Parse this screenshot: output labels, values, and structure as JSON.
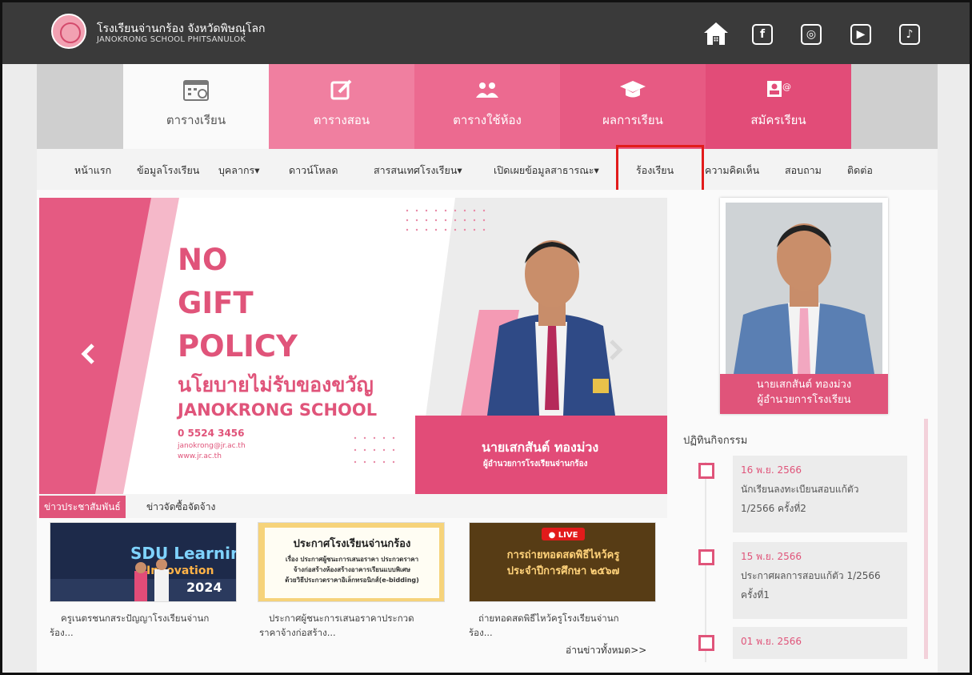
{
  "header": {
    "school_name_th": "โรงเรียนจ่านกร้อง จังหวัดพิษณุโลก",
    "school_name_en": "JANOKRONG SCHOOL PHITSANULOK",
    "icons": [
      "home-icon",
      "facebook-icon",
      "instagram-icon",
      "youtube-icon",
      "tiktok-icon"
    ],
    "icon_glyphs": {
      "facebook": "f",
      "instagram": "◎",
      "youtube": "▶",
      "tiktok": "♪"
    }
  },
  "tiles": [
    {
      "label": "ตารางเรียน",
      "icon": "calendar-icon"
    },
    {
      "label": "ตารางสอน",
      "icon": "edit-icon"
    },
    {
      "label": "ตารางใช้ห้อง",
      "icon": "users-icon"
    },
    {
      "label": "ผลการเรียน",
      "icon": "graduation-cap-icon"
    },
    {
      "label": "สมัครเรียน",
      "icon": "contact-card-icon"
    }
  ],
  "nav": {
    "home": "หน้าแรก",
    "school_info": "ข้อมูลโรงเรียน",
    "personnel": "บุคลากร▾",
    "download": "ดาวน์โหลด",
    "info_system": "สารสนเทศโรงเรียน▾",
    "public_info": "เปิดเผยข้อมูลสาธารณะ▾",
    "complaint": "ร้องเรียน",
    "opinion": "ความคิดเห็น",
    "survey": "สอบถาม",
    "contact": "ติดต่อ"
  },
  "banner": {
    "line1": "NO",
    "line2": "GIFT",
    "line3": "POLICY",
    "policy_th": "นโยบายไม่รับของขวัญ",
    "school": "JANOKRONG SCHOOL",
    "phone": "0 5524 3456",
    "email": "janokrong@jr.ac.th",
    "web": "www.jr.ac.th",
    "director_name": "นายเสกสันต์ ทองม่วง",
    "director_title": "ผู้อำนวยการโรงเรียนจ่านกร้อง"
  },
  "news": {
    "tabs": [
      "ข่าวประชาสัมพันธ์",
      "ข่าวจัดซื้อจัดจ้าง"
    ],
    "items": [
      {
        "caption_l1": "ครูเนตรชนกสระปัญญาโรงเรียนจ่านก",
        "caption_l2": "ร้อง..."
      },
      {
        "caption_l1": "ประกาศผู้ชนะการเสนอราคาประกวด",
        "caption_l2": "ราคาจ้างก่อสร้าง..."
      },
      {
        "caption_l1": "ถ่ายทอดสดพิธีไหว้ครูโรงเรียนจ่านก",
        "caption_l2": "ร้อง..."
      }
    ],
    "card2": {
      "title": "ประกาศโรงเรียนจ่านกร้อง",
      "l1": "เรื่อง ประกาศผู้ชนะการเสนอราคา ประกวดราคา",
      "l2": "จ้างก่อสร้างห้องสร้างอาคารเรียนแบบพิเศษ",
      "l3": "ด้วยวิธีประกวดราคาอิเล็กทรอนิกส์(e-bidding)"
    },
    "card1": {
      "brand": "SDU Learning",
      "sub": "Innovation",
      "year": "2024"
    },
    "card3": {
      "live": "● LIVE",
      "l1": "การถ่ายทอดสดพิธีไหว้ครู",
      "l2": "ประจำปีการศึกษา ๒๕๖๗"
    },
    "read_all": "อ่านข่าวทั้งหมด>>"
  },
  "director": {
    "name": "นายเสกสันต์   ทองม่วง",
    "title": "ผู้อำนวยการโรงเรียน"
  },
  "calendar": {
    "title": "ปฏิทินกิจกรรม",
    "events": [
      {
        "date": "16 พ.ย. 2566",
        "l1": "นักเรียนลงทะเบียนสอบแก้ตัว",
        "l2": "1/2566 ครั้งที่2"
      },
      {
        "date": "15 พ.ย. 2566",
        "l1": "ประกาศผลการสอบแก้ตัว 1/2566",
        "l2": "ครั้งที่1"
      },
      {
        "date": "01 พ.ย. 2566",
        "l1": "",
        "l2": ""
      }
    ]
  },
  "colors": {
    "accent": "#e0547a",
    "topbar": "#3a3a3a",
    "highlight": "#e21b1b"
  }
}
